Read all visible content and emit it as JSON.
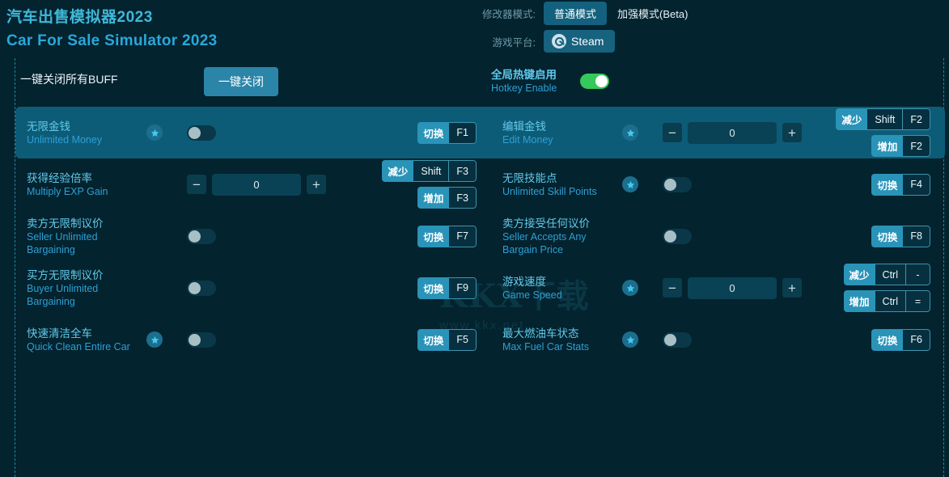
{
  "header": {
    "title_zh": "汽车出售模拟器2023",
    "title_en": "Car For Sale Simulator 2023",
    "mode_label": "修改器模式:",
    "mode_normal": "普通模式",
    "mode_enhanced": "加强模式(Beta)",
    "platform_label": "游戏平台:",
    "platform_value": "Steam",
    "platform_icon": "steam-icon"
  },
  "topbar": {
    "close_all_label": "一键关闭所有BUFF",
    "close_all_button": "一键关闭",
    "hotkey_zh": "全局热键启用",
    "hotkey_en": "Hotkey Enable",
    "hotkey_state": "on"
  },
  "watermark": {
    "big": "KKX下载",
    "small": "www.kkx.net"
  },
  "colors": {
    "background": "#03232f",
    "row_highlight": "#0d5c77",
    "accent_blue": "#2a93b8",
    "title_cyan": "#3fb8d8",
    "toggle_on_green": "#35c85a",
    "star_badge": "#1b6f8d"
  },
  "rows": [
    {
      "left": {
        "name_zh": "无限金钱",
        "name_en": "Unlimited Money",
        "star": true,
        "control": "toggle",
        "toggle_state": "off",
        "hotkeys": [
          {
            "action": "切换",
            "keys": [
              "F1"
            ]
          }
        ]
      },
      "right": {
        "name_zh": "编辑金钱",
        "name_en": "Edit Money",
        "star": true,
        "control": "stepper",
        "value": "0",
        "minus": "−",
        "plus": "+",
        "hotkeys": [
          {
            "action": "减少",
            "keys": [
              "Shift",
              "F2"
            ]
          },
          {
            "action": "增加",
            "keys": [
              "F2"
            ]
          }
        ]
      },
      "highlight": true
    },
    {
      "left": {
        "name_zh": "获得经验倍率",
        "name_en": "Multiply EXP Gain",
        "star": false,
        "control": "stepper",
        "value": "0",
        "minus": "−",
        "plus": "+",
        "hotkeys": [
          {
            "action": "减少",
            "keys": [
              "Shift",
              "F3"
            ]
          },
          {
            "action": "增加",
            "keys": [
              "F3"
            ]
          }
        ]
      },
      "right": {
        "name_zh": "无限技能点",
        "name_en": "Unlimited Skill Points",
        "star": true,
        "control": "toggle",
        "toggle_state": "off",
        "hotkeys": [
          {
            "action": "切换",
            "keys": [
              "F4"
            ]
          }
        ]
      },
      "highlight": false
    },
    {
      "left": {
        "name_zh": "卖方无限制议价",
        "name_en": "Seller Unlimited Bargaining",
        "star": false,
        "control": "toggle",
        "toggle_state": "off",
        "hotkeys": [
          {
            "action": "切换",
            "keys": [
              "F7"
            ]
          }
        ]
      },
      "right": {
        "name_zh": "卖方接受任何议价",
        "name_en": "Seller Accepts Any Bargain Price",
        "star": false,
        "control": "toggle",
        "toggle_state": "off",
        "hotkeys": [
          {
            "action": "切换",
            "keys": [
              "F8"
            ]
          }
        ]
      },
      "highlight": false
    },
    {
      "left": {
        "name_zh": "买方无限制议价",
        "name_en": "Buyer Unlimited Bargaining",
        "star": false,
        "control": "toggle",
        "toggle_state": "off",
        "hotkeys": [
          {
            "action": "切换",
            "keys": [
              "F9"
            ]
          }
        ]
      },
      "right": {
        "name_zh": "游戏速度",
        "name_en": "Game Speed",
        "star": true,
        "control": "stepper",
        "value": "0",
        "minus": "−",
        "plus": "+",
        "hotkeys": [
          {
            "action": "减少",
            "keys": [
              "Ctrl",
              "-"
            ]
          },
          {
            "action": "增加",
            "keys": [
              "Ctrl",
              "="
            ]
          }
        ]
      },
      "highlight": false
    },
    {
      "left": {
        "name_zh": "快速清洁全车",
        "name_en": "Quick Clean Entire Car",
        "star": true,
        "control": "toggle",
        "toggle_state": "off",
        "hotkeys": [
          {
            "action": "切换",
            "keys": [
              "F5"
            ]
          }
        ]
      },
      "right": {
        "name_zh": "最大燃油车状态",
        "name_en": "Max Fuel Car Stats",
        "star": true,
        "control": "toggle",
        "toggle_state": "off",
        "hotkeys": [
          {
            "action": "切换",
            "keys": [
              "F6"
            ]
          }
        ]
      },
      "highlight": false
    }
  ]
}
